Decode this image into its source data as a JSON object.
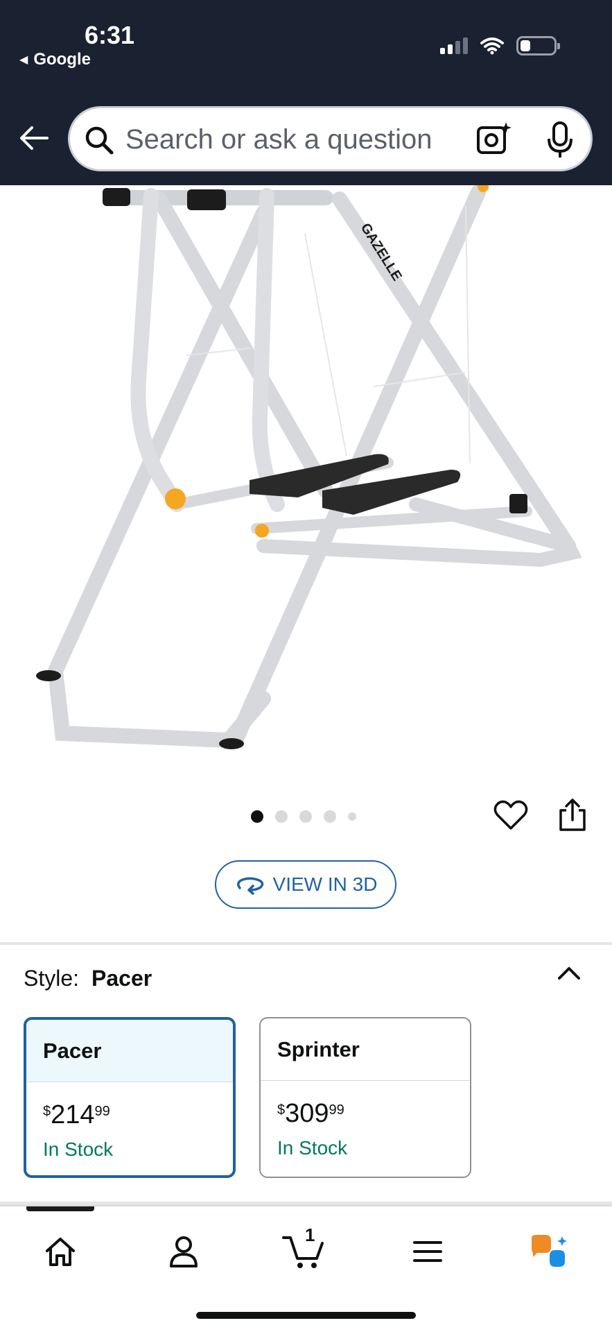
{
  "status_bar": {
    "time": "6:31",
    "back_app": "Google"
  },
  "search": {
    "placeholder": "Search or ask a question"
  },
  "product": {
    "image_description_icon": "elliptical-glider-image",
    "carousel": {
      "total": 5,
      "active": 1
    },
    "view3d_label": "VIEW IN 3D"
  },
  "style": {
    "label": "Style:",
    "selected": "Pacer",
    "options": [
      {
        "name": "Pacer",
        "currency": "$",
        "whole": "214",
        "cents": "99",
        "stock": "In Stock",
        "selected": true
      },
      {
        "name": "Sprinter",
        "currency": "$",
        "whole": "309",
        "cents": "99",
        "stock": "In Stock",
        "selected": false
      }
    ]
  },
  "bottom_nav": {
    "items": [
      "home-icon",
      "account-icon",
      "cart-icon",
      "menu-icon",
      "rufus-icon"
    ],
    "cart_count": "1"
  },
  "colors": {
    "header_bg": "#1a2130",
    "link_blue": "#2162a1",
    "in_stock_green": "#007a5e",
    "selected_bg": "#edf8fd",
    "accent_orange": "#f08a24",
    "accent_blue": "#1a8fe3"
  }
}
